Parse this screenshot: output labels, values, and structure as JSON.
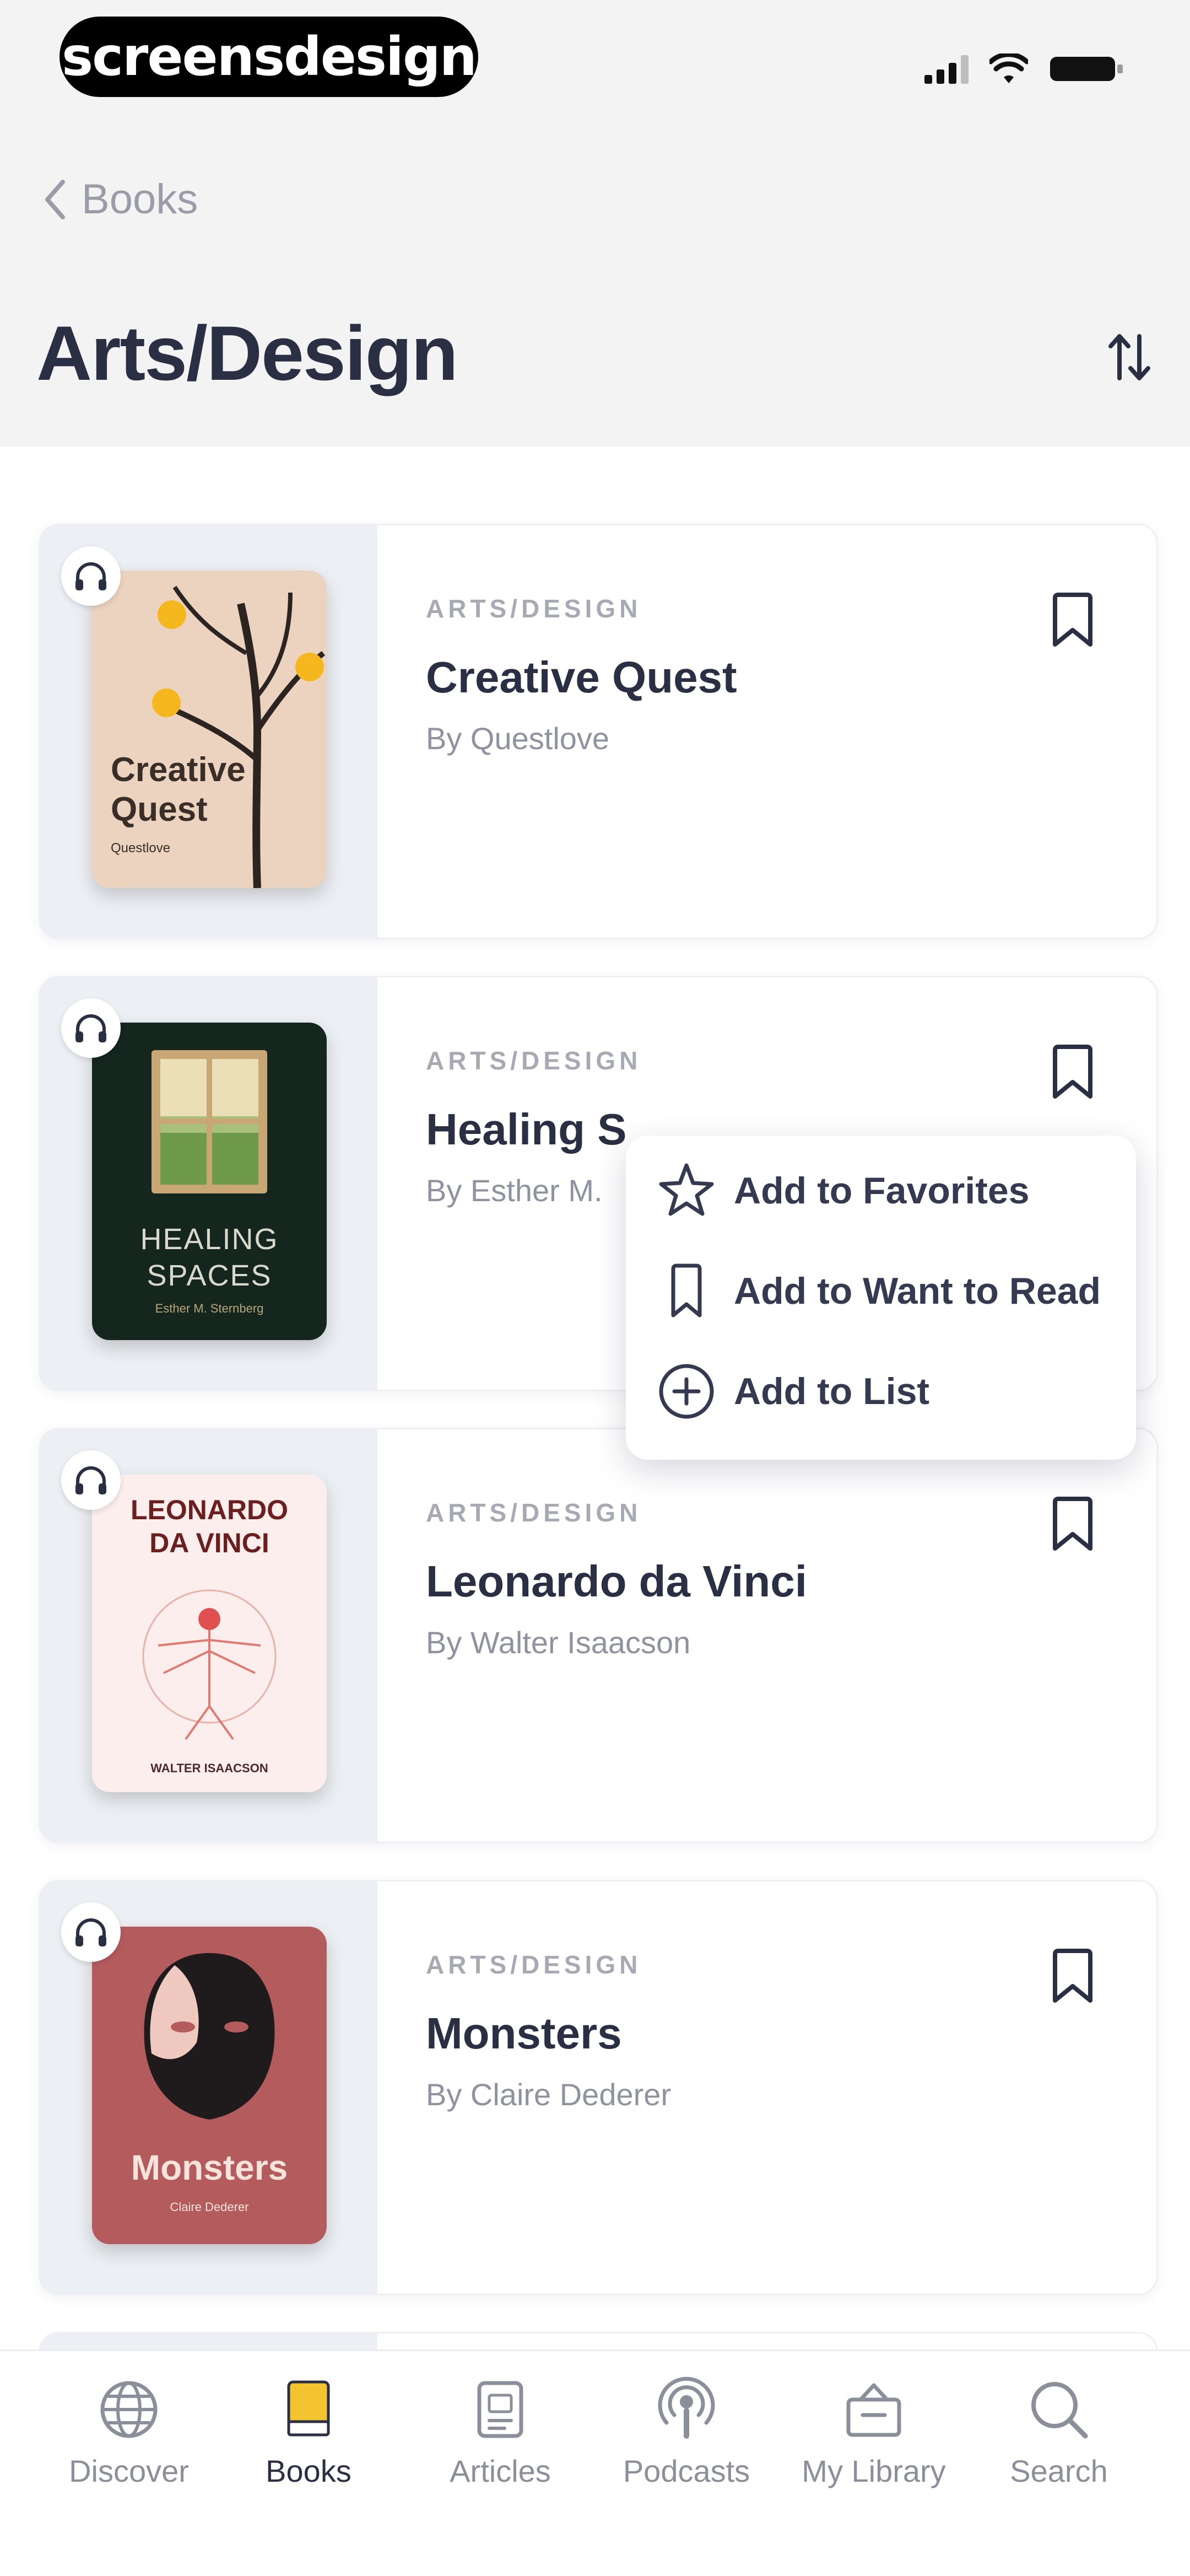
{
  "status_bar": {
    "brand": "screensdesign"
  },
  "nav": {
    "back_label": "Books",
    "title": "Arts/Design"
  },
  "books": [
    {
      "category": "ARTS/DESIGN",
      "title": "Creative Quest",
      "author": "By Questlove",
      "cover_title_line1": "Creative",
      "cover_title_line2": "Quest",
      "cover_author": "Questlove"
    },
    {
      "category": "ARTS/DESIGN",
      "title": "Healing S",
      "author": "By Esther M.",
      "cover_title_line1": "HEALING",
      "cover_title_line2": "SPACES",
      "cover_author": "Esther M. Sternberg"
    },
    {
      "category": "ARTS/DESIGN",
      "title": "Leonardo da Vinci",
      "author": "By Walter Isaacson",
      "cover_title_line1": "LEONARDO",
      "cover_title_line2": "DA VINCI",
      "cover_author": "WALTER ISAACSON"
    },
    {
      "category": "ARTS/DESIGN",
      "title": "Monsters",
      "author": "By Claire Dederer",
      "cover_title_line1": "Monsters",
      "cover_author": "Claire Dederer"
    }
  ],
  "menu": {
    "favorites": "Add to Favorites",
    "want_to_read": "Add to Want to Read",
    "add_to_list": "Add to List"
  },
  "tabs": [
    {
      "label": "Discover",
      "icon": "globe-icon"
    },
    {
      "label": "Books",
      "icon": "book-icon",
      "active": true
    },
    {
      "label": "Articles",
      "icon": "article-icon"
    },
    {
      "label": "Podcasts",
      "icon": "podcast-icon"
    },
    {
      "label": "My Library",
      "icon": "library-icon"
    },
    {
      "label": "Search",
      "icon": "search-icon"
    }
  ],
  "colors": {
    "accent_yellow": "#f4c430",
    "text_dark": "#2b2f44",
    "muted": "#8f93a0"
  }
}
